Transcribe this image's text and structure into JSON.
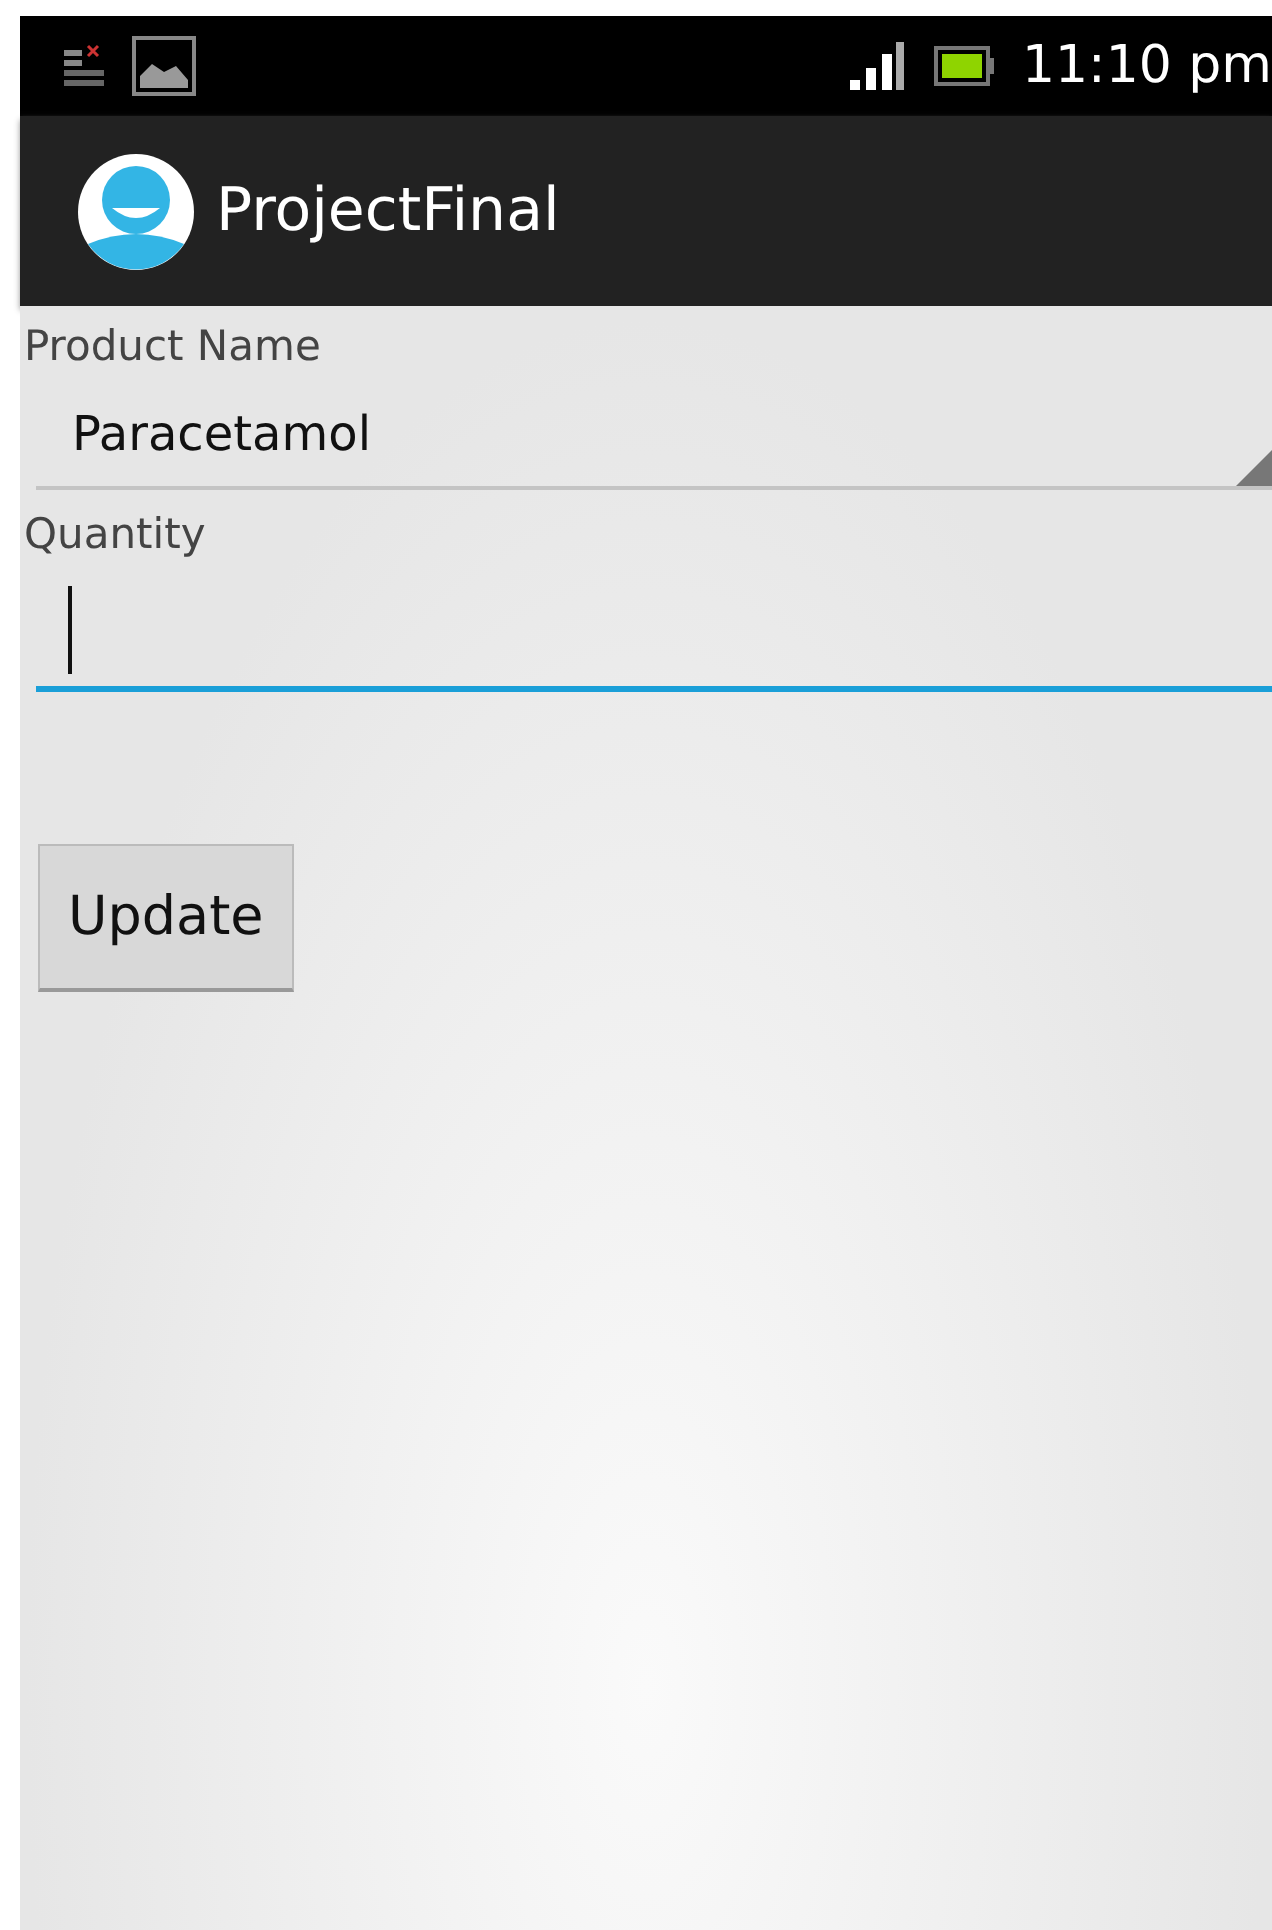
{
  "status_bar": {
    "time": "11:10 pm"
  },
  "action_bar": {
    "title": "ProjectFinal"
  },
  "form": [
    {
      "kind": "spinner",
      "label": "Product Name",
      "value": "Paracetamol"
    },
    {
      "kind": "text",
      "label": "Quantity",
      "focused": true
    }
  ],
  "buttons": [
    "Update"
  ]
}
